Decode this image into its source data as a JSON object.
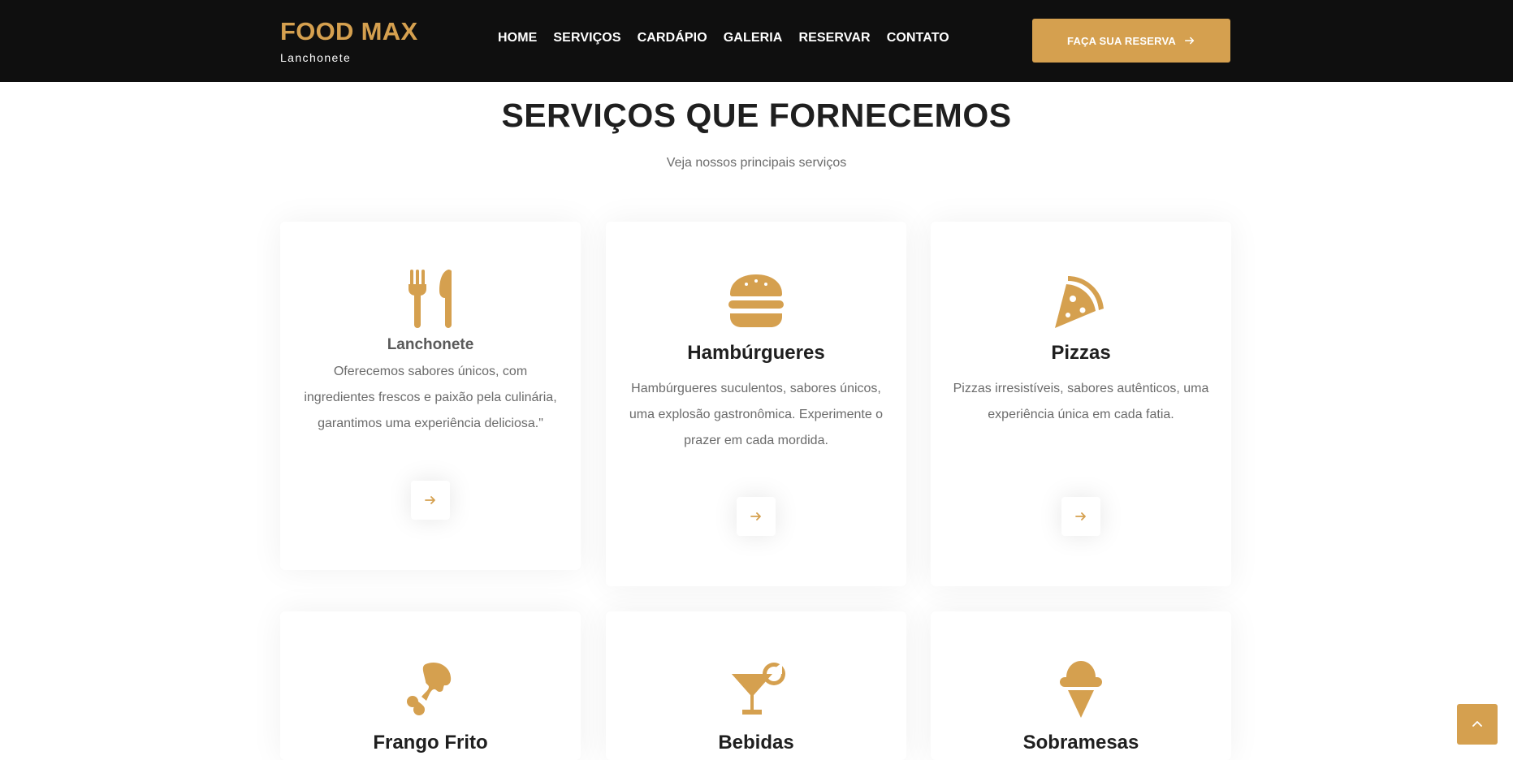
{
  "brand": {
    "name": "FOOD MAX",
    "subtitle": "Lanchonete"
  },
  "nav": {
    "items": [
      {
        "label": "HOME"
      },
      {
        "label": "SERVIÇOS"
      },
      {
        "label": "CARDÁPIO"
      },
      {
        "label": "GALERIA"
      },
      {
        "label": "RESERVAR"
      },
      {
        "label": "CONTATO"
      }
    ],
    "cta_label": "FAÇA SUA RESERVA",
    "cta_icon": "arrow-right-icon"
  },
  "section": {
    "title": "SERVIÇOS QUE FORNECEMOS",
    "subtitle": "Veja nossos principais serviços"
  },
  "cards": [
    {
      "title": "Lanchonete",
      "description": "Oferecemos sabores únicos, com ingredientes frescos e paixão pela culinária, garantimos uma experiência deliciosa.\"",
      "icon": "utensils-icon"
    },
    {
      "title": "Hambúrgueres",
      "description": "Hambúrgueres suculentos, sabores únicos, uma explosão gastronômica. Experimente o prazer em cada mordida.",
      "icon": "burger-icon"
    },
    {
      "title": "Pizzas",
      "description": "Pizzas irresistíveis, sabores autênticos, uma experiência única em cada fatia.",
      "icon": "pizza-slice-icon"
    },
    {
      "title": "Frango Frito",
      "icon": "drumstick-icon"
    },
    {
      "title": "Bebidas",
      "icon": "cocktail-icon"
    },
    {
      "title": "Sobramesas",
      "icon": "ice-cream-icon"
    }
  ],
  "colors": {
    "accent": "#d5a04f",
    "header_bg": "#0f0f0f",
    "text_dark": "#1f1f1f",
    "text_muted": "#6b6b6b"
  },
  "scroll_top_icon": "chevron-up-icon"
}
